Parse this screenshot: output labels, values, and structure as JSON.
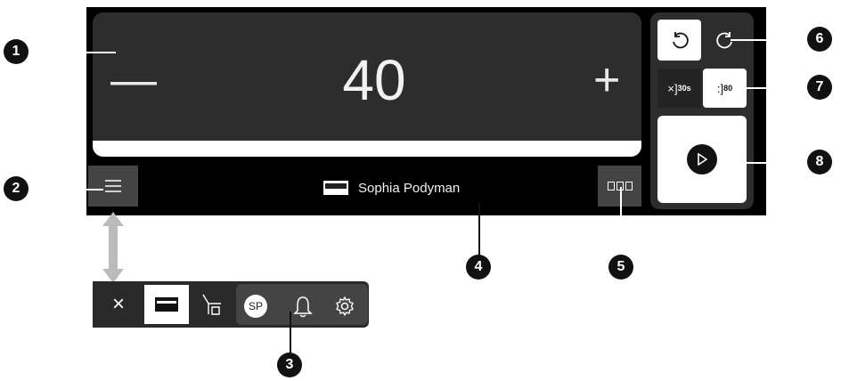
{
  "stepper": {
    "minus": "—",
    "value": "40",
    "plus": "+"
  },
  "user": {
    "name": "Sophia Podyman"
  },
  "timer": {
    "main": "×]",
    "sub": "30s"
  },
  "counter": {
    "main": ":]",
    "sub": "80"
  },
  "toolbar": {
    "close": "×",
    "avatar": "SP"
  },
  "callouts": [
    "1",
    "2",
    "3",
    "4",
    "5",
    "6",
    "7",
    "8"
  ]
}
